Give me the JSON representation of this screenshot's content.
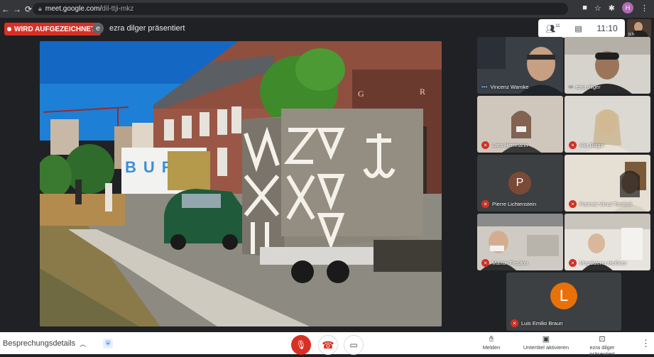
{
  "browser": {
    "url_host": "meet.google.com/",
    "url_path": "dil-ttji-mkz",
    "avatar_letter": "H"
  },
  "meeting": {
    "recording_label": "WIRD AUFGEZEICHNET",
    "presenter_initial": "e",
    "presenter_text": "ezra dilger präsentiert",
    "participants_badge": "11",
    "clock": "11:10",
    "self_label": "Ich"
  },
  "presentation": {
    "truck_text": "BURG"
  },
  "participants": [
    {
      "name": "Vincenz Warnke",
      "muted": false
    },
    {
      "name": "ezra dilger",
      "muted": false
    },
    {
      "name": "Lara Herrmann",
      "muted": true
    },
    {
      "name": "Alia Bigga",
      "muted": true
    },
    {
      "name": "Pierre Lichtenstein",
      "muted": true,
      "initial": "P"
    },
    {
      "name": "Parinati Vimal Tamboli",
      "muted": true
    },
    {
      "name": "Manon Freulon",
      "muted": true
    },
    {
      "name": "Magdalena Meißner",
      "muted": true
    },
    {
      "name": "Luis Emilio Braun",
      "muted": true,
      "initial": "L"
    }
  ],
  "bottom": {
    "details_label": "Besprechungsdetails",
    "report_label": "Melden",
    "captions_label": "Untertitel aktivieren",
    "present_label": "ezra dilger präsentiert"
  },
  "colors": {
    "record_red": "#d93025",
    "avatar_brown": "#7b4a36",
    "avatar_orange": "#e8710a"
  }
}
